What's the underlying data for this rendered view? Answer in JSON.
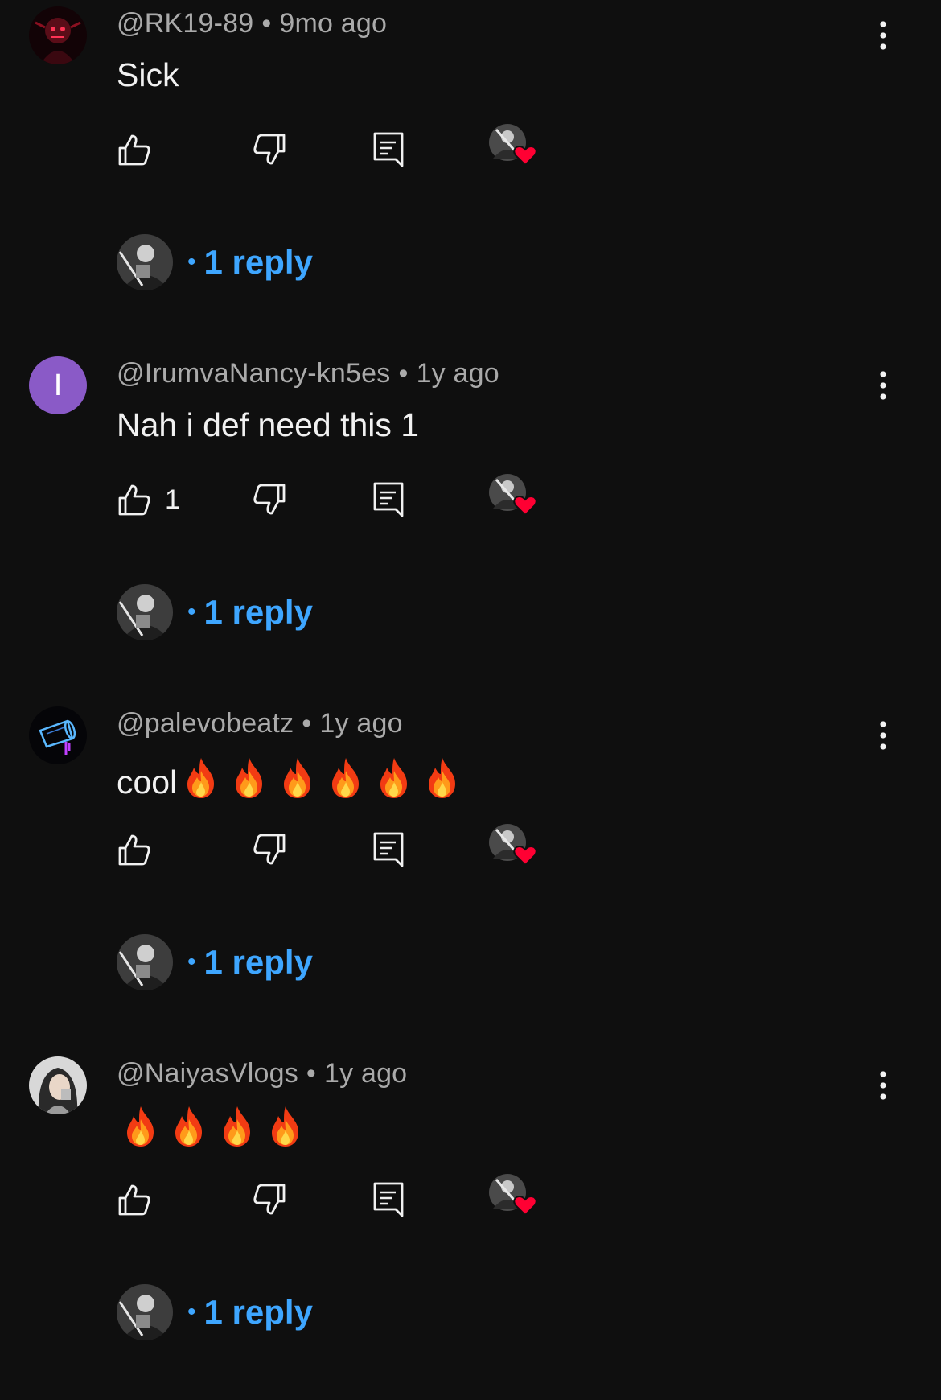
{
  "comments": [
    {
      "handle": "@RK19-89",
      "time": "9mo ago",
      "text": "Sick",
      "flames": 0,
      "like_count": "",
      "avatar": "dark-red-mask-avatar",
      "replies_label": "1 reply"
    },
    {
      "handle": "@IrumvaNancy-kn5es",
      "time": "1y ago",
      "text": "Nah i def need this 1",
      "flames": 0,
      "like_count": "1",
      "avatar_letter": "I",
      "avatar_color": "#8a5ac7",
      "replies_label": "1 reply"
    },
    {
      "handle": "@palevobeatz",
      "time": "1y ago",
      "text": "cool",
      "flames": 6,
      "like_count": "",
      "avatar": "neon-cup-avatar",
      "replies_label": "1 reply"
    },
    {
      "handle": "@NaiyasVlogs",
      "time": "1y ago",
      "text": "",
      "flames": 4,
      "like_count": "",
      "avatar": "photo-avatar",
      "replies_label": "1 reply"
    }
  ],
  "separator": "•",
  "colors": {
    "background": "#0f0f0f",
    "link": "#3ea6ff",
    "heart": "#ff0033",
    "meta": "#aaaaaa"
  },
  "icons": [
    "thumb-up-icon",
    "thumb-down-icon",
    "reply-icon",
    "creator-heart-icon",
    "more-vert-icon",
    "fire-emoji"
  ]
}
